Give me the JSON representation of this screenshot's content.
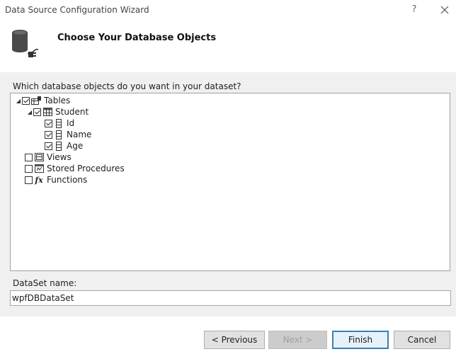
{
  "window": {
    "title": "Data Source Configuration Wizard",
    "help_glyph": "?"
  },
  "header": {
    "title": "Choose Your Database Objects",
    "icon": "database-plug-icon"
  },
  "main": {
    "question": "Which database objects do you want in your dataset?",
    "tree": {
      "tables": {
        "label": "Tables",
        "checked": true,
        "expanded": true
      },
      "student": {
        "label": "Student",
        "checked": true,
        "expanded": true
      },
      "columns": [
        {
          "label": "Id",
          "checked": true
        },
        {
          "label": "Name",
          "checked": true
        },
        {
          "label": "Age",
          "checked": true
        }
      ],
      "views": {
        "label": "Views",
        "checked": false
      },
      "stored_procedures": {
        "label": "Stored Procedures",
        "checked": false
      },
      "functions": {
        "label": "Functions",
        "checked": false
      }
    }
  },
  "dataset": {
    "label": "DataSet name:",
    "value": "wpfDBDataSet"
  },
  "footer": {
    "previous": "< Previous",
    "next": "Next >",
    "finish": "Finish",
    "cancel": "Cancel"
  }
}
